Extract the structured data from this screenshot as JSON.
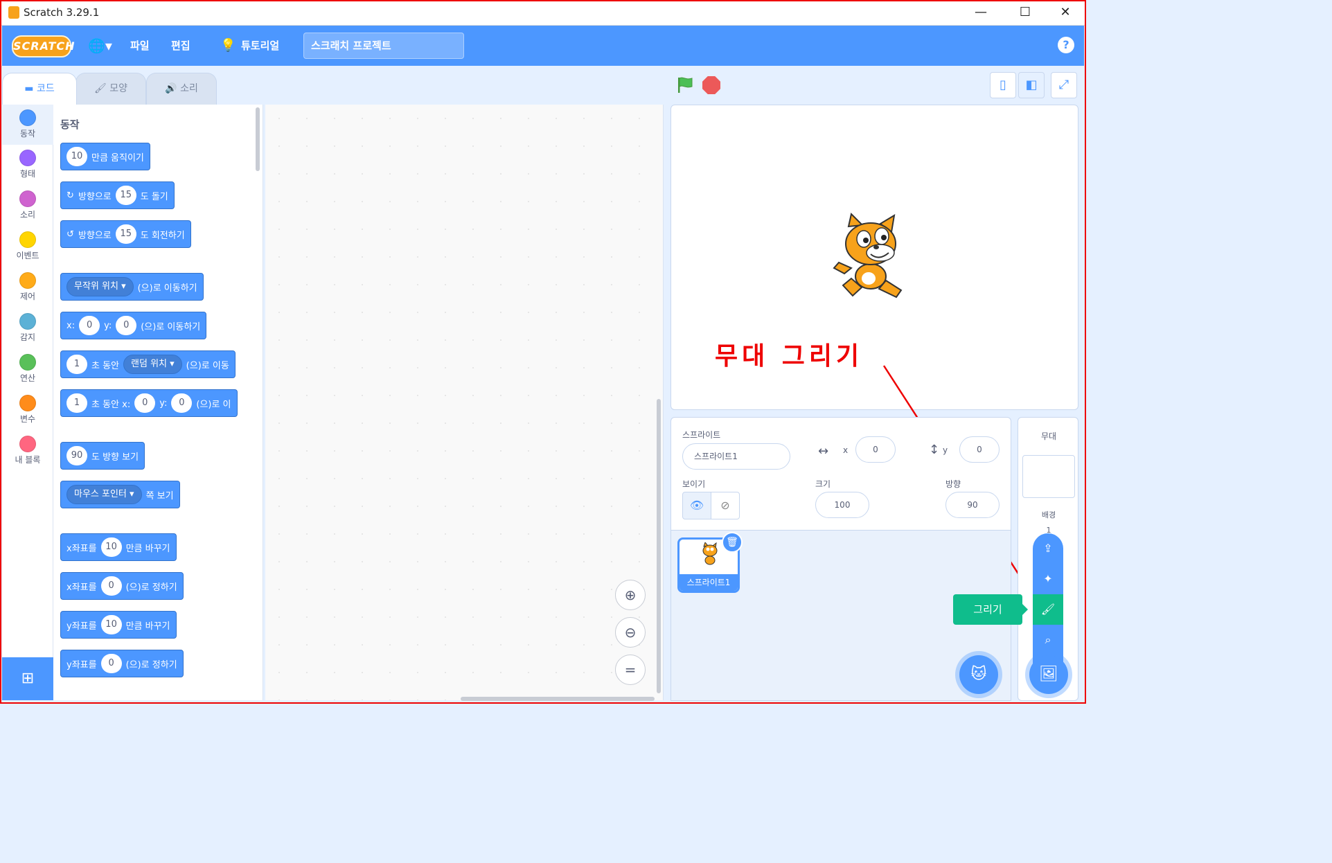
{
  "window": {
    "title": "Scratch 3.29.1",
    "minimize": "—",
    "maximize": "☐",
    "close": "✕"
  },
  "menubar": {
    "logo": "SCRATCH",
    "file": "파일",
    "edit": "편집",
    "tutorial": "튜토리얼",
    "project_title": "스크래치 프로젝트",
    "help": "?"
  },
  "tabs": [
    {
      "label": "코드"
    },
    {
      "label": "모양"
    },
    {
      "label": "소리"
    }
  ],
  "categories": [
    {
      "label": "동작",
      "color": "#4c97ff"
    },
    {
      "label": "형태",
      "color": "#9966ff"
    },
    {
      "label": "소리",
      "color": "#cf63cf"
    },
    {
      "label": "이벤트",
      "color": "#ffd500"
    },
    {
      "label": "제어",
      "color": "#ffab19"
    },
    {
      "label": "감지",
      "color": "#5cb1d6"
    },
    {
      "label": "연산",
      "color": "#59c059"
    },
    {
      "label": "변수",
      "color": "#ff8c1a"
    },
    {
      "label": "내 블록",
      "color": "#ff6680"
    }
  ],
  "palette": {
    "heading": "동작",
    "b1": {
      "v": "10",
      "t": "만큼 움직이기"
    },
    "b2": {
      "t1": "방향으로",
      "v": "15",
      "t2": "도 돌기"
    },
    "b3": {
      "t1": "방향으로",
      "v": "15",
      "t2": "도 회전하기"
    },
    "b4": {
      "d": "무작위 위치",
      "t": "(으)로 이동하기"
    },
    "b5": {
      "x": "x:",
      "xv": "0",
      "y": "y:",
      "yv": "0",
      "t": "(으)로 이동하기"
    },
    "b6": {
      "v": "1",
      "t1": "초 동안",
      "d": "랜덤 위치",
      "t2": "(으)로 이동"
    },
    "b7": {
      "v": "1",
      "t1": "초 동안 x:",
      "xv": "0",
      "y": "y:",
      "yv": "0",
      "t2": "(으)로 이"
    },
    "b8": {
      "v": "90",
      "t": "도 방향 보기"
    },
    "b9": {
      "d": "마우스 포인터",
      "t": "쪽 보기"
    },
    "b10": {
      "t1": "x좌표를",
      "v": "10",
      "t2": "만큼 바꾸기"
    },
    "b11": {
      "t1": "x좌표를",
      "v": "0",
      "t2": "(으)로 정하기"
    },
    "b12": {
      "t1": "y좌표를",
      "v": "10",
      "t2": "만큼 바꾸기"
    },
    "b13": {
      "t1": "y좌표를",
      "v": "0",
      "t2": "(으)로 정하기"
    }
  },
  "annotation": "무대 그리기",
  "sprite_info": {
    "sprite_label": "스프라이트",
    "sprite_name": "스프라이트1",
    "x_label": "x",
    "x": "0",
    "y_label": "y",
    "y": "0",
    "show_label": "보이기",
    "size_label": "크기",
    "size": "100",
    "direction_label": "방향",
    "direction": "90"
  },
  "sprite_list": [
    {
      "name": "스프라이트1"
    }
  ],
  "stage_panel": {
    "title": "무대",
    "backdrops_label": "배경",
    "backdrop_count": "1"
  },
  "tooltip": "그리기"
}
